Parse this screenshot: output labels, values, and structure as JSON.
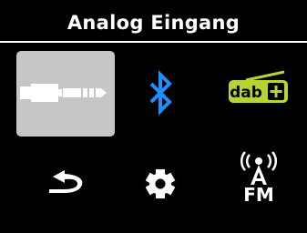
{
  "header": {
    "title": "Analog Eingang"
  },
  "menu": {
    "selected": "analog-input",
    "items": [
      {
        "id": "analog-input",
        "icon": "audio-jack-icon",
        "selected": true
      },
      {
        "id": "bluetooth",
        "icon": "bluetooth-icon",
        "selected": false
      },
      {
        "id": "dab",
        "icon": "dab-plus-icon",
        "label": "dab+",
        "selected": false
      },
      {
        "id": "back",
        "icon": "back-arrow-icon",
        "selected": false
      },
      {
        "id": "settings",
        "icon": "gear-icon",
        "selected": false
      },
      {
        "id": "fm",
        "icon": "fm-radio-icon",
        "label": "FM",
        "selected": false
      }
    ]
  },
  "colors": {
    "background": "#000000",
    "text": "#ffffff",
    "selection": "#c6c6c6",
    "bluetooth": "#1e90ff",
    "dab": "#b7d433"
  }
}
